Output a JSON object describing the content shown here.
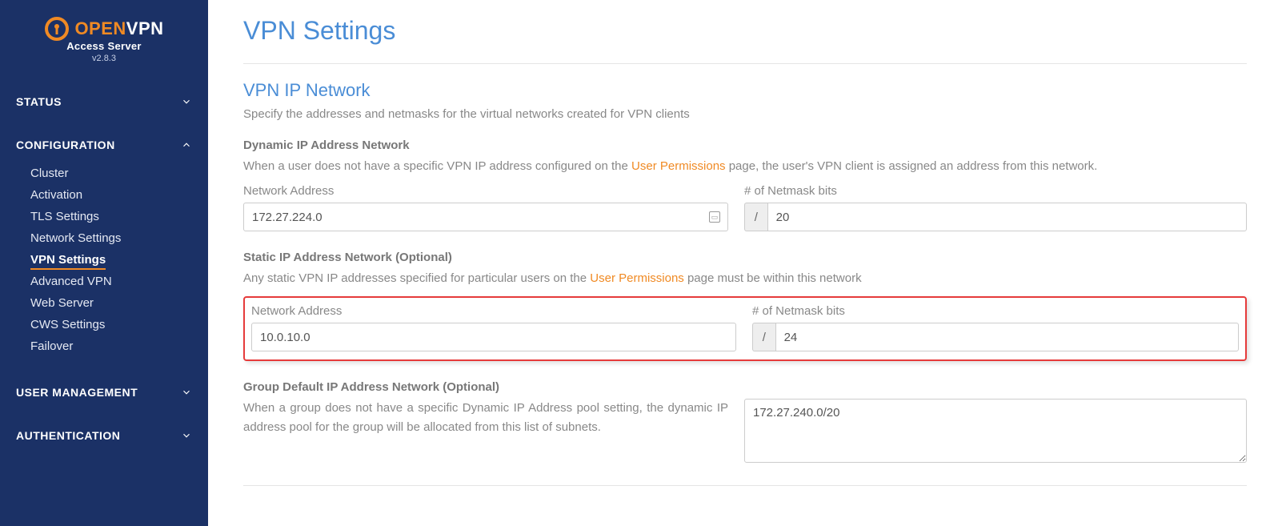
{
  "brand": {
    "open": "OPEN",
    "vpn": "VPN",
    "sub": "Access Server",
    "version": "v2.8.3"
  },
  "nav": {
    "status": "STATUS",
    "config": "CONFIGURATION",
    "user_mgmt": "USER  MANAGEMENT",
    "auth": "AUTHENTICATION",
    "items": {
      "cluster": "Cluster",
      "activation": "Activation",
      "tls": "TLS Settings",
      "network": "Network Settings",
      "vpn": "VPN Settings",
      "advanced": "Advanced VPN",
      "web": "Web Server",
      "cws": "CWS Settings",
      "failover": "Failover"
    }
  },
  "page": {
    "title": "VPN Settings",
    "section_title": "VPN IP Network",
    "section_desc": "Specify the addresses and netmasks for the virtual networks created for VPN clients",
    "dynamic": {
      "heading": "Dynamic IP Address Network",
      "desc_pre": "When a user does not have a specific VPN IP address configured on the ",
      "link": "User Permissions",
      "desc_post": " page, the user's VPN client is assigned an address from this network.",
      "addr_label": "Network Address",
      "mask_label": "# of Netmask bits",
      "addr_value": "172.27.224.0",
      "mask_value": "20",
      "slash": "/"
    },
    "static": {
      "heading": "Static IP Address Network (Optional)",
      "desc_pre": "Any static VPN IP addresses specified for particular users on the ",
      "link": "User Permissions",
      "desc_post": " page must be within this network",
      "addr_label": "Network Address",
      "mask_label": "# of Netmask bits",
      "addr_value": "10.0.10.0",
      "mask_value": "24",
      "slash": "/"
    },
    "group": {
      "heading": "Group Default IP Address Network (Optional)",
      "desc": "When a group does not have a specific Dynamic IP Address pool setting, the dynamic IP address pool for the group will be allocated from this list of subnets.",
      "value": "172.27.240.0/20"
    }
  }
}
